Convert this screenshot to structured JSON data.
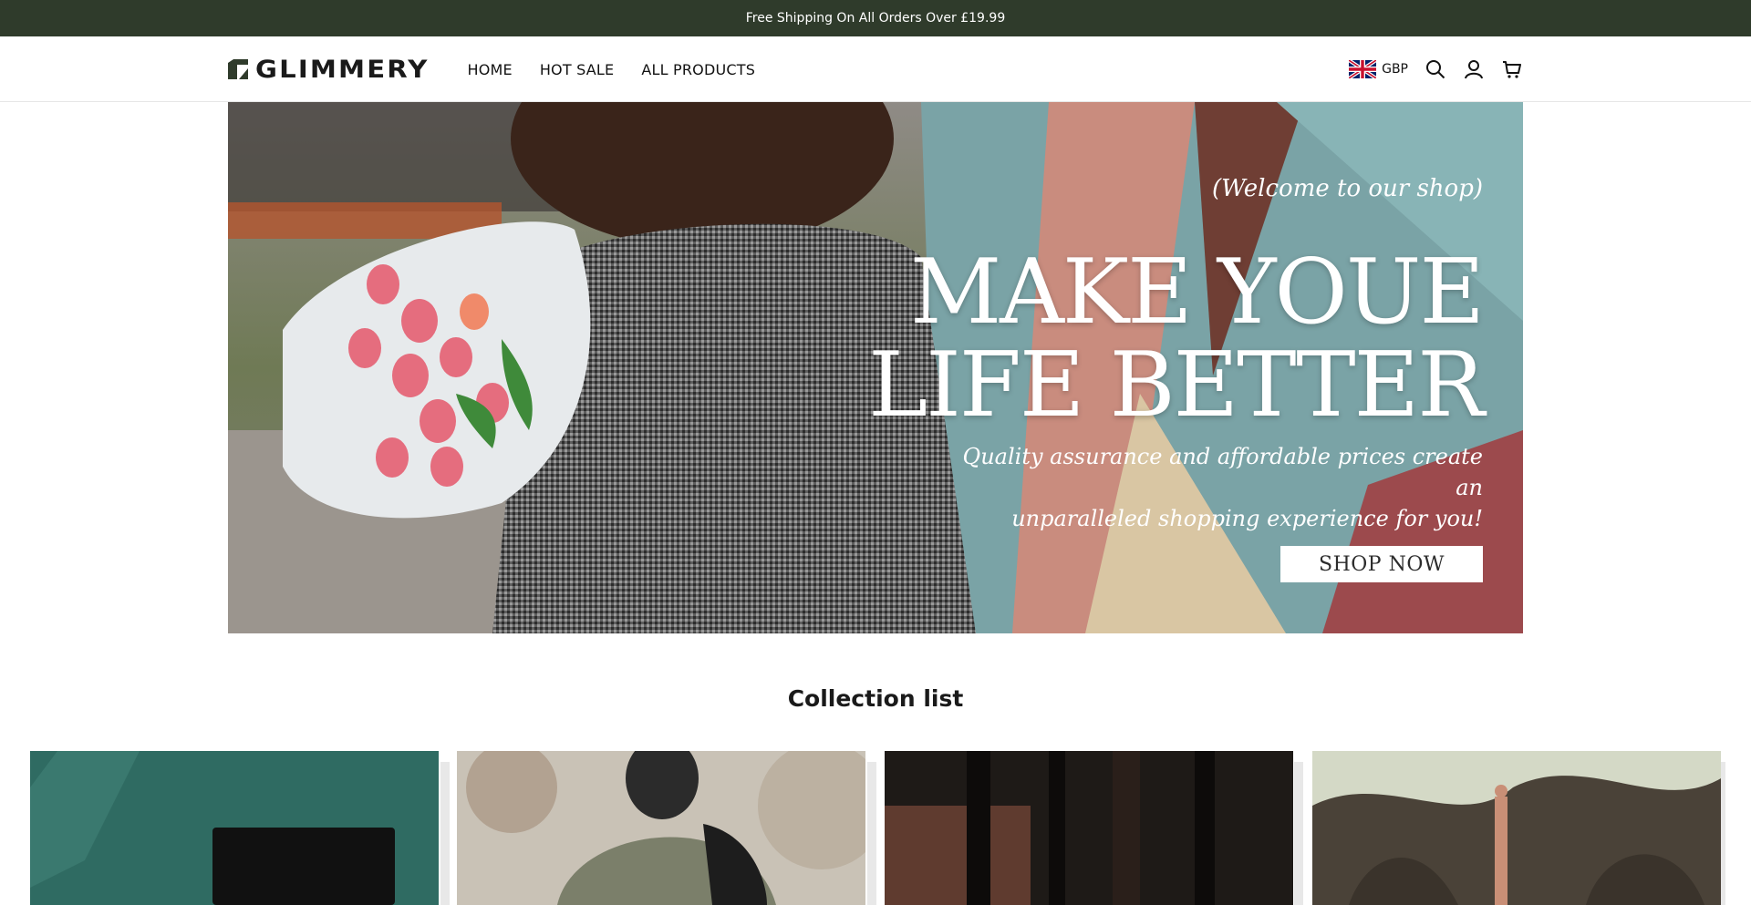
{
  "announcement": {
    "text": "Free Shipping On All Orders Over £19.99"
  },
  "header": {
    "logo_text": "GLIMMERY",
    "nav": [
      {
        "label": "HOME"
      },
      {
        "label": "HOT SALE"
      },
      {
        "label": "ALL PRODUCTS"
      }
    ],
    "currency": {
      "code": "GBP",
      "flag_icon": "uk-flag-icon"
    },
    "icons": [
      "search-icon",
      "account-icon",
      "cart-icon"
    ]
  },
  "hero": {
    "welcome": "(Welcome to our shop)",
    "headline_line1": "MAKE YOUE",
    "headline_line2": "LIFE BETTER",
    "subline_line1": "Quality assurance and affordable prices create an",
    "subline_line2": "unparalleled shopping experience for you!",
    "cta_label": "SHOP NOW"
  },
  "collections": {
    "title": "Collection list",
    "cards": [
      {
        "image": "tablet-on-green-wall-photo"
      },
      {
        "image": "man-with-backpack-photo"
      },
      {
        "image": "dark-trees-photo"
      },
      {
        "image": "person-in-tree-photo"
      }
    ]
  },
  "colors": {
    "announcement_bg": "#2f3b2b",
    "hero_cta_bg": "#ffffff"
  }
}
